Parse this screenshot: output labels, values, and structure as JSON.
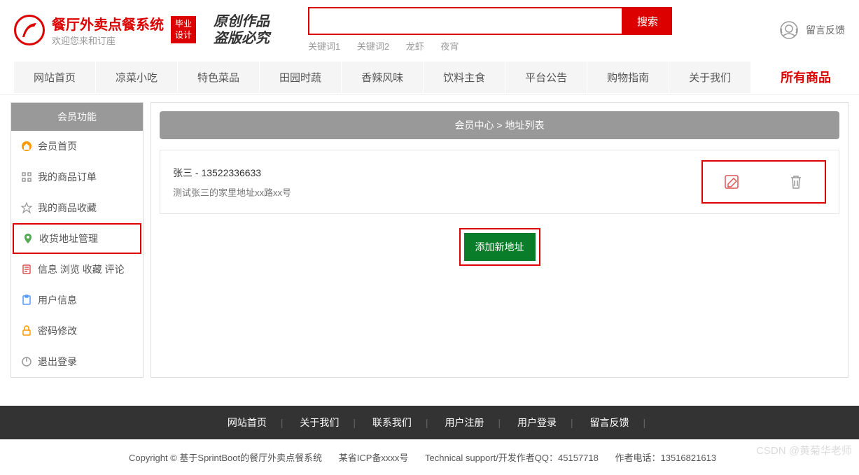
{
  "header": {
    "logo_title": "餐厅外卖点餐系统",
    "logo_sub": "欢迎您来和订座",
    "grad_badge": "毕业\n设计",
    "brush_line1": "原创作品",
    "brush_line2": "盗版必究"
  },
  "search": {
    "value": "",
    "placeholder": "",
    "button_label": "搜索",
    "keywords": [
      "关键词1",
      "关键词2",
      "龙虾",
      "夜宵"
    ]
  },
  "feedback": {
    "label": "留言反馈"
  },
  "nav": {
    "items": [
      "网站首页",
      "凉菜小吃",
      "特色菜品",
      "田园时蔬",
      "香辣风味",
      "饮料主食",
      "平台公告",
      "购物指南",
      "关于我们"
    ],
    "all_products": "所有商品"
  },
  "sidebar": {
    "header": "会员功能",
    "items": [
      {
        "icon": "home",
        "label": "会员首页",
        "color": "icon-orange"
      },
      {
        "icon": "grid",
        "label": "我的商品订单",
        "color": "icon-gray"
      },
      {
        "icon": "star",
        "label": "我的商品收藏",
        "color": "icon-gray"
      },
      {
        "icon": "location",
        "label": "收货地址管理",
        "color": "icon-green",
        "active": true
      },
      {
        "icon": "doc",
        "label": "信息 浏览 收藏 评论",
        "color": "icon-red"
      },
      {
        "icon": "clipboard",
        "label": "用户信息",
        "color": "icon-blue"
      },
      {
        "icon": "lock",
        "label": "密码修改",
        "color": "icon-orange"
      },
      {
        "icon": "power",
        "label": "退出登录",
        "color": "icon-gray"
      }
    ]
  },
  "content": {
    "breadcrumb": "会员中心 > 地址列表",
    "address": {
      "name_phone": "张三 - 13522336633",
      "detail": "测试张三的家里地址xx路xx号"
    },
    "add_button": "添加新地址"
  },
  "footer_nav": [
    "网站首页",
    "关于我们",
    "联系我们",
    "用户注册",
    "用户登录",
    "留言反馈"
  ],
  "footer_info": {
    "copyright": "Copyright © 基于SprintBoot的餐厅外卖点餐系统",
    "icp": "某省ICP备xxxx号",
    "support": "Technical support/开发作者QQ：45157718",
    "phone": "作者电话：13516821613"
  },
  "watermark": "CSDN @黄菊华老师"
}
